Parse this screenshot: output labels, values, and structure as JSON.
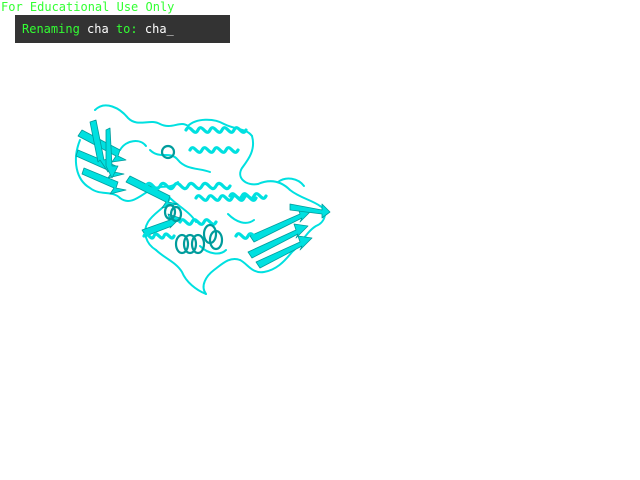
{
  "watermark": "For Educational Use Only",
  "rename_prompt": {
    "label_prefix": "Renaming",
    "old_name": "cha",
    "label_mid": "to:",
    "new_name": "cha_"
  },
  "molecule": {
    "representation": "cartoon",
    "color": "#00e0e0",
    "shade": "#009c9c"
  }
}
